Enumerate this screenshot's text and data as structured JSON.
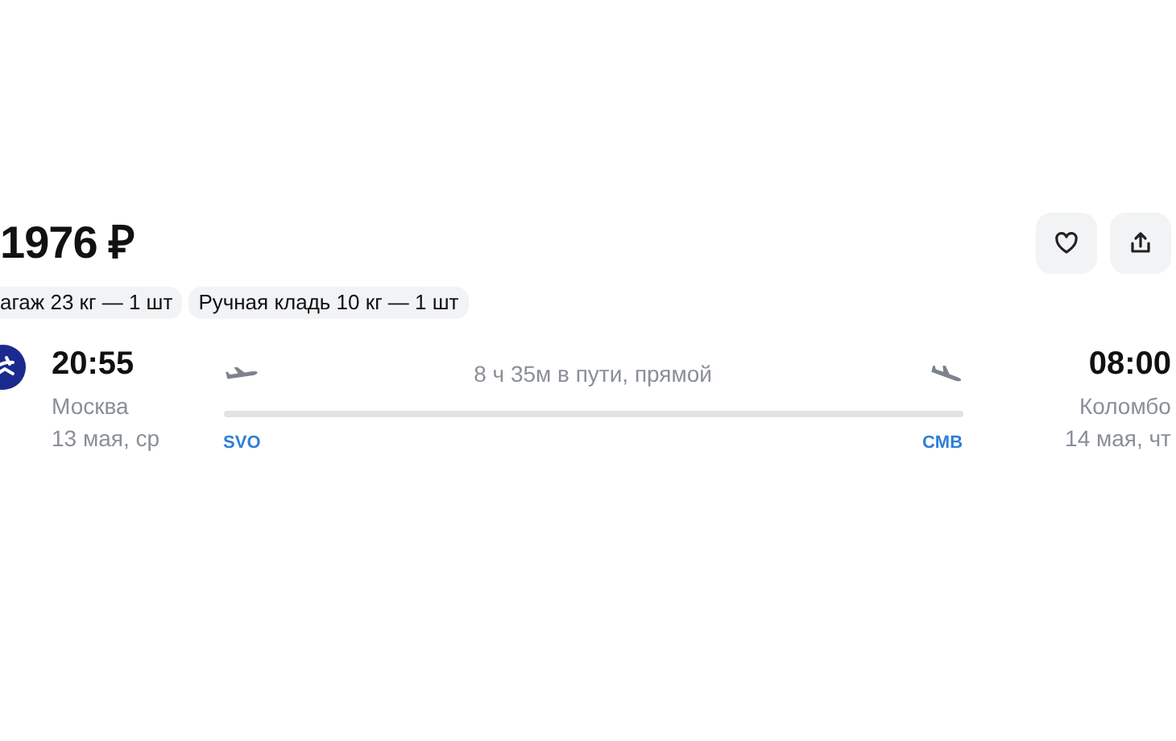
{
  "price": "1976 ₽",
  "actions": [
    {
      "kind": "favorite"
    },
    {
      "kind": "share"
    }
  ],
  "baggage": [
    "агаж 23 кг — 1 шт",
    "Ручная кладь 10 кг — 1 шт"
  ],
  "flight": {
    "departure": {
      "time": "20:55",
      "city": "Москва",
      "date": "13 мая, ср",
      "airport": "SVO"
    },
    "duration": "8 ч 35м в пути, прямой",
    "arrival": {
      "time": "08:00",
      "city": "Коломбо",
      "date": "14 мая, чт",
      "airport": "CMB"
    }
  }
}
